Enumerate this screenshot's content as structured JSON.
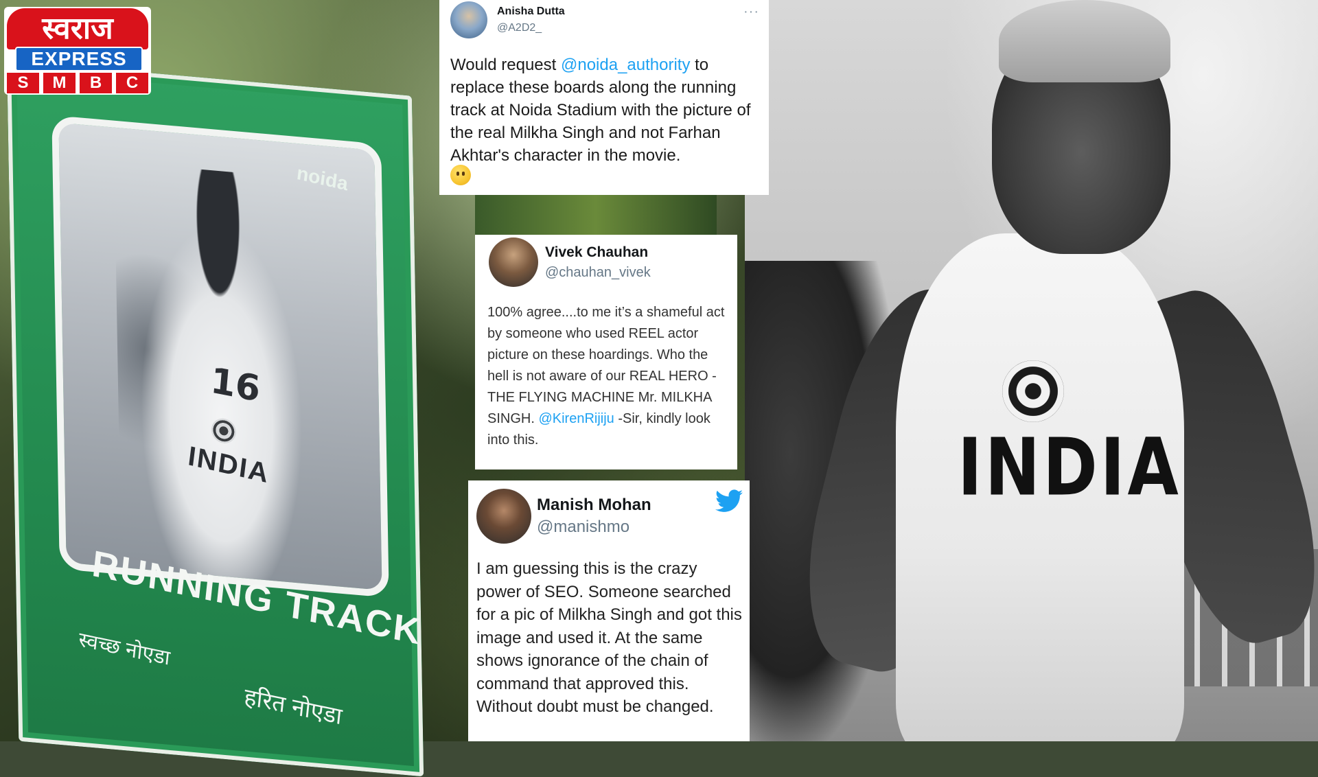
{
  "logo": {
    "top_text": "स्वराज",
    "express": "EXPRESS",
    "letters": [
      "S",
      "M",
      "B",
      "C"
    ]
  },
  "sign": {
    "brand": "noida",
    "jersey_number": "16",
    "jersey_text": "INDIA",
    "title": "RUNNING TRACK",
    "footer_left": "स्वच्छ नोएडा",
    "footer_right": "हरित नोएडा"
  },
  "photo": {
    "vest_text": "INDIA"
  },
  "tweets": [
    {
      "name": "Anisha Dutta",
      "handle": "@A2D2_",
      "more": "···",
      "body_pre": "Would request ",
      "mention": "@noida_authority",
      "body_post": " to replace these boards along the running track at Noida Stadium with the picture of the real Milkha Singh and not Farhan Akhtar's character in the movie."
    },
    {
      "name": "Vivek Chauhan",
      "handle": "@chauhan_vivek",
      "body_pre": "100% agree....to me it’s a shameful act by someone who used REEL actor picture on these hoardings. Who the hell is not aware of our REAL HERO -THE FLYING MACHINE Mr. MILKHA SINGH. ",
      "mention": "@KirenRijiju",
      "body_post": " -Sir, kindly look into this."
    },
    {
      "name": "Manish Mohan",
      "handle": "@manishmo",
      "body": "I am guessing this is the crazy power of SEO. Someone searched for a pic of Milkha Singh and got this image and used it. At the same shows ignorance of the chain of command that approved this. Without doubt must be changed."
    }
  ],
  "colors": {
    "mention": "#1da1f2",
    "twitter_blue": "#1da1f2",
    "logo_red": "#d9121b",
    "logo_blue": "#1764c4",
    "sign_green": "#238a4f"
  },
  "icons": [
    "twitter-bird-icon",
    "more-options-icon",
    "emoji-icon"
  ]
}
